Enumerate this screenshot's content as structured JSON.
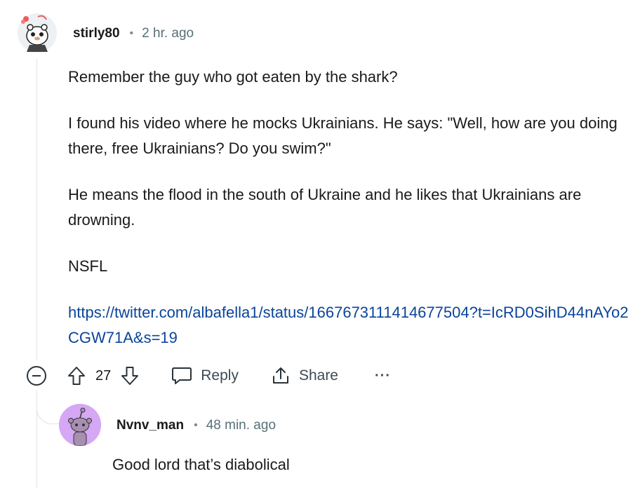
{
  "comment": {
    "author": "stirly80",
    "separator": "•",
    "time": "2 hr. ago",
    "paragraphs": [
      "Remember the guy who got eaten by the shark?",
      "I found his video where he mocks Ukrainians. He says: \"Well, how are you doing there, free Ukrainians? Do you swim?\"",
      "He means the flood in the south of Ukraine and he likes that Ukrainians are drowning.",
      "NSFL"
    ],
    "link": "https://twitter.com/albafella1/status/1667673111414677504?t=IcRD0SihD44nAYo2CGW71A&s=19",
    "score": "27",
    "reply_label": "Reply",
    "share_label": "Share",
    "more_label": "···"
  },
  "reply": {
    "author": "Nvnv_man",
    "separator": "•",
    "time": "48 min. ago",
    "text": "Good lord that’s diabolical"
  },
  "colors": {
    "link": "#0a449b",
    "meta": "#576f76",
    "avatar2_bg": "#d5a7f5",
    "thread_line": "#dfe3e6"
  },
  "icons": [
    "snoo-avatar-icon",
    "collapse-icon",
    "upvote-icon",
    "downvote-icon",
    "comment-icon",
    "share-icon",
    "more-icon"
  ]
}
